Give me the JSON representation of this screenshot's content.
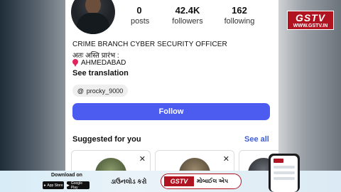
{
  "profile": {
    "stats": [
      {
        "value": "0",
        "label": "posts"
      },
      {
        "value": "42.4K",
        "label": "followers"
      },
      {
        "value": "162",
        "label": "following"
      }
    ],
    "bio_title": "CRIME BRANCH CYBER SECURITY OFFICER",
    "bio_hindi": "अतः अस्ति प्रारंभ :",
    "location": "AHMEDABAD",
    "see_translation": "See translation",
    "threads_handle": "procky_9000",
    "follow_label": "Follow"
  },
  "suggested": {
    "title": "Suggested for you",
    "see_all": "See all",
    "close_glyph": "✕"
  },
  "logo": {
    "name": "GSTV",
    "url": "WWW.GSTV.IN"
  },
  "banner": {
    "download_on": "Download on",
    "app_store": "App Store",
    "google_play": "Google Play",
    "download_text": "ડાઉનલોડ કરો",
    "app_name": "GSTV",
    "mobile_app": "મોબાઈલ એપ"
  },
  "colors": {
    "follow_blue": "#4c5cf0",
    "link_blue": "#3f5fd6",
    "brand_red": "#b01420"
  },
  "icons": [
    "location-pin-icon",
    "threads-icon",
    "close-icon",
    "apple-icon",
    "google-play-icon"
  ]
}
